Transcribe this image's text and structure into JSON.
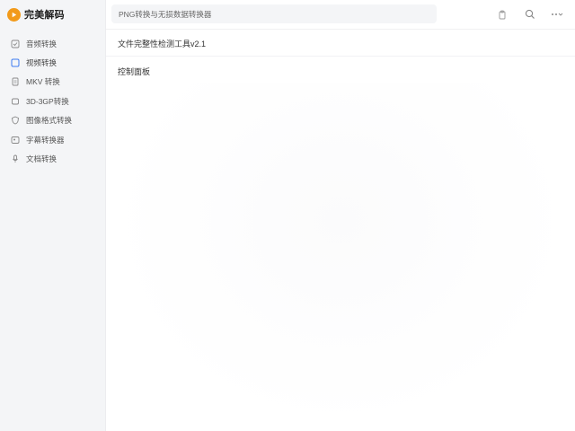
{
  "app": {
    "name": "完美解码",
    "logo_icon": "play-logo-icon",
    "accent_color": "#f29a1a"
  },
  "search": {
    "value": "PNG转换与无损数据转换器"
  },
  "toolbar": {
    "icons": [
      "clipboard-icon",
      "search-icon",
      "more-icon"
    ]
  },
  "sidebar": {
    "items": [
      {
        "label": "音频转换",
        "icon": "checkbox-icon"
      },
      {
        "label": "视频转换",
        "icon": "square-icon"
      },
      {
        "label": "MKV 转换",
        "icon": "document-icon"
      },
      {
        "label": "3D-3GP转换",
        "icon": "cube-icon"
      },
      {
        "label": "图像格式转换",
        "icon": "shield-icon"
      },
      {
        "label": "字幕转换器",
        "icon": "image-icon"
      },
      {
        "label": "文档转换",
        "icon": "microphone-icon"
      }
    ],
    "active_index": 1
  },
  "main": {
    "title": "文件完整性检测工具v2.1",
    "section_label": "控制面板"
  }
}
